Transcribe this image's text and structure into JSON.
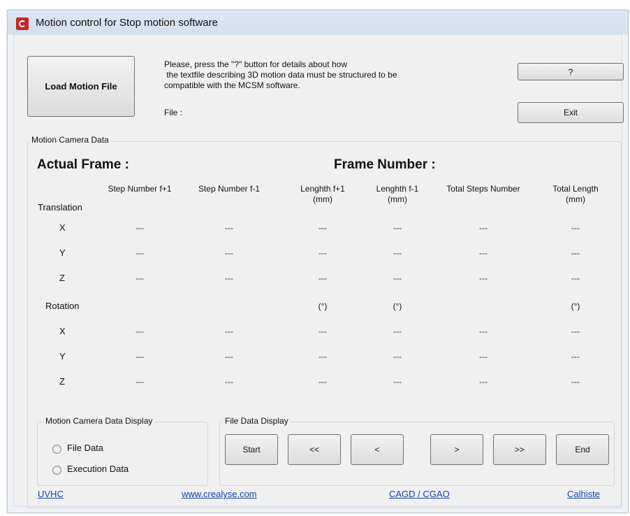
{
  "window": {
    "title": "Motion control for Stop motion software"
  },
  "top": {
    "load_button": "Load Motion File",
    "help_lines": [
      "Please, press the \"?\" button for details about how",
      " the textfile describing 3D motion data must be structured to be",
      "compatible with the MCSM software."
    ],
    "file_label": "File :",
    "question_button": "?",
    "exit_button": "Exit"
  },
  "motion_group": {
    "title": "Motion Camera Data",
    "actual_frame": "Actual Frame :",
    "frame_number": "Frame Number :",
    "columns": [
      "Step Number f+1",
      "Step Number f-1",
      "Lenghth f+1\n(mm)",
      "Lenghth f-1\n(mm)",
      "Total Steps Number",
      "Total Length\n(mm)"
    ],
    "translation_label": "Translation",
    "rotation_label": "Rotation",
    "axes": [
      "X",
      "Y",
      "Z"
    ],
    "placeholder": "---",
    "degree_unit": "(°)",
    "translation_rows": [
      [
        "---",
        "---",
        "---",
        "---",
        "---",
        "---"
      ],
      [
        "---",
        "---",
        "---",
        "---",
        "---",
        "---"
      ],
      [
        "---",
        "---",
        "---",
        "---",
        "---",
        "---"
      ]
    ],
    "rotation_units": [
      "",
      "",
      "(°)",
      "(°)",
      "",
      "(°)"
    ],
    "rotation_rows": [
      [
        "---",
        "---",
        "---",
        "---",
        "---",
        "---"
      ],
      [
        "---",
        "---",
        "---",
        "---",
        "---",
        "---"
      ],
      [
        "---",
        "---",
        "---",
        "---",
        "---",
        "---"
      ]
    ]
  },
  "display_group": {
    "title": "Motion Camera Data Display",
    "options": [
      "File Data",
      "Execution Data"
    ]
  },
  "file_display": {
    "title": "File Data Display",
    "buttons": [
      "Start",
      "<<",
      "<",
      ">",
      ">>",
      "End"
    ]
  },
  "footer_links": [
    "UVHC",
    "www.crealyse.com",
    "CAGD / CGAO",
    "Calhiste"
  ]
}
